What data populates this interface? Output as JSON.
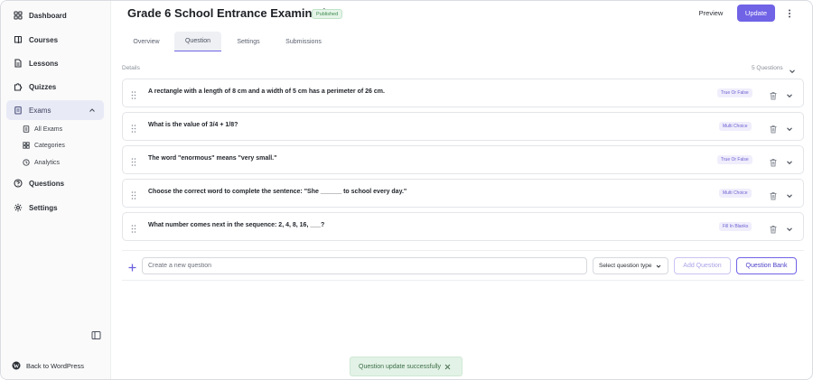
{
  "sidebar": {
    "nav": {
      "dashboard": "Dashboard",
      "courses": "Courses",
      "lessons": "Lessons",
      "quizzes": "Quizzes",
      "exams": "Exams",
      "questions": "Questions",
      "settings": "Settings"
    },
    "exams_sub": {
      "all_exams": "All Exams",
      "categories": "Categories",
      "analytics": "Analytics"
    },
    "back_to_wordpress": "Back to WordPress"
  },
  "header": {
    "title": "Grade 6 School Entrance Examination",
    "status": "Published",
    "preview_label": "Preview",
    "update_label": "Update"
  },
  "tabs": {
    "overview": "Overview",
    "question": "Question",
    "settings": "Settings",
    "submissions": "Submissions"
  },
  "details": {
    "label": "Details",
    "count": "5 Questions"
  },
  "questions": [
    {
      "text": "A rectangle with a length of 8 cm and a width of 5 cm has a perimeter of 26 cm.",
      "type": "True Or False"
    },
    {
      "text": "What is the value of 3/4 + 1/8?",
      "type": "Multi Choice"
    },
    {
      "text": "The word \"enormous\" means \"very small.\"",
      "type": "True Or False"
    },
    {
      "text": "Choose the correct word to complete the sentence: \"She ______ to school every day.\"",
      "type": "Multi Choice"
    },
    {
      "text": "What number comes next in the sequence: 2, 4, 8, 16, ___?",
      "type": "Fill In Blanks"
    }
  ],
  "create": {
    "placeholder": "Create a new question",
    "select_label": "Select question type",
    "add_label": "Add Question",
    "bank_label": "Question Bank"
  },
  "toast": {
    "message": "Question update successfully"
  },
  "colors": {
    "accent": "#7063e6",
    "published_green": "#3a8a4c",
    "toast_bg": "#e3f2e6"
  },
  "icons": {
    "dashboard": "grid-icon",
    "courses": "book-icon",
    "lessons": "document-icon",
    "quizzes": "puzzle-icon",
    "exams": "clipboard-icon",
    "questions": "question-circle-icon",
    "settings": "gear-icon"
  }
}
